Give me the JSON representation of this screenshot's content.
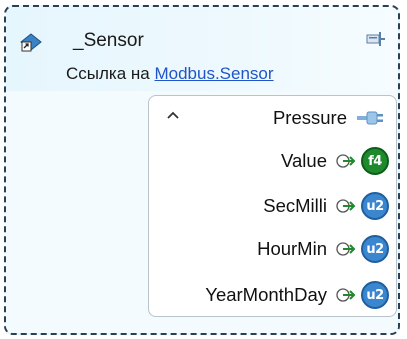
{
  "node": {
    "title": "_Sensor",
    "link_prefix": "Ссылка на",
    "link_text": "Modbus.Sensor",
    "icon": "class-node-icon",
    "pin_icon": "pin-icon"
  },
  "panel": {
    "collapse_icon": "chevron-up-icon",
    "group": {
      "label": "Pressure",
      "icon": "plug-icon"
    },
    "fields": [
      {
        "label": "Value",
        "type": "f4",
        "color": "#1f8a2d"
      },
      {
        "label": "SecMilli",
        "type": "u2",
        "color": "#3a87cf"
      },
      {
        "label": "HourMin",
        "type": "u2",
        "color": "#3a87cf"
      },
      {
        "label": "YearMonthDay",
        "type": "u2",
        "color": "#3a87cf"
      }
    ]
  },
  "colors": {
    "border": "#2b3f52",
    "link": "#1f55c7",
    "header_bg": "#e6f6fd"
  }
}
